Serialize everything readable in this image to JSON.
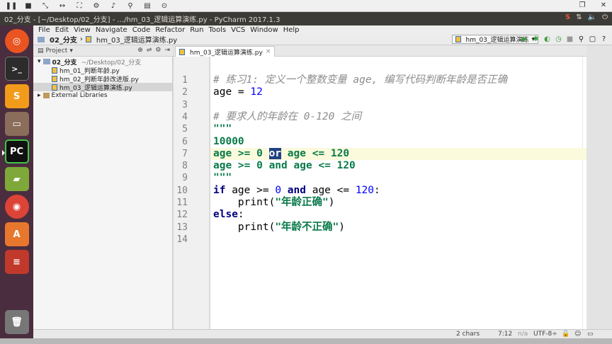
{
  "recorder": {
    "icons": [
      "pause-icon",
      "stop-icon",
      "resize-icon",
      "move-icon",
      "settings-icon",
      "mic-icon",
      "save-icon",
      "record-icon"
    ]
  },
  "window": {
    "title": "02_分支 - [~/Desktop/02_分支] - .../hm_03_逻辑运算演练.py - PyCharm 2017.1.3"
  },
  "menu": [
    "File",
    "Edit",
    "View",
    "Navigate",
    "Code",
    "Refactor",
    "Run",
    "Tools",
    "VCS",
    "Window",
    "Help"
  ],
  "nav": {
    "project": "02_分支",
    "file": "hm_03_逻辑运算演练.py",
    "run_config": "hm_03_逻辑运算演练"
  },
  "project_panel": {
    "header": "Project",
    "root_name": "02_分支",
    "root_path": "~/Desktop/02_分支",
    "files": [
      "hm_01_判断年龄.py",
      "hm_02_判断年龄改进版.py",
      "hm_03_逻辑运算演练.py"
    ],
    "selected_index": 2,
    "external": "External Libraries"
  },
  "editor": {
    "tab_label": "hm_03_逻辑运算演练.py",
    "current_line": 7,
    "line_numbers": [
      "1",
      "2",
      "3",
      "4",
      "5",
      "6",
      "7",
      "8",
      "9",
      "10",
      "11",
      "12",
      "13",
      "14"
    ],
    "lines": [
      [
        {
          "t": "# 练习1: 定义一个整数变量 age, 编写代码判断年龄是否正确",
          "c": "comment"
        }
      ],
      [
        {
          "t": "age = ",
          "c": "op"
        },
        {
          "t": "12",
          "c": "num"
        }
      ],
      [],
      [
        {
          "t": "# 要求人的年龄在 0-120 之间",
          "c": "comment"
        }
      ],
      [
        {
          "t": "\"\"\"",
          "c": "str"
        }
      ],
      [
        {
          "t": "10000",
          "c": "str"
        }
      ],
      [
        {
          "t": "age >= 0 ",
          "c": "str"
        },
        {
          "t": "or",
          "c": "sel"
        },
        {
          "t": " age <= 120",
          "c": "str"
        }
      ],
      [
        {
          "t": "age >= 0 and age <= 120",
          "c": "str"
        }
      ],
      [
        {
          "t": "\"\"\"",
          "c": "str"
        }
      ],
      [
        {
          "t": "if",
          "c": "kw"
        },
        {
          "t": " age >= ",
          "c": "op"
        },
        {
          "t": "0",
          "c": "num"
        },
        {
          "t": " ",
          "c": "op"
        },
        {
          "t": "and",
          "c": "kw"
        },
        {
          "t": " age <= ",
          "c": "op"
        },
        {
          "t": "120",
          "c": "num"
        },
        {
          "t": ":",
          "c": "op"
        }
      ],
      [
        {
          "t": "    print(",
          "c": "op"
        },
        {
          "t": "\"年龄正确\"",
          "c": "str"
        },
        {
          "t": ")",
          "c": "op"
        }
      ],
      [
        {
          "t": "else",
          "c": "kw"
        },
        {
          "t": ":",
          "c": "op"
        }
      ],
      [
        {
          "t": "    print(",
          "c": "op"
        },
        {
          "t": "\"年龄不正确\"",
          "c": "str"
        },
        {
          "t": ")",
          "c": "op"
        }
      ],
      []
    ]
  },
  "status": {
    "chars": "2 chars",
    "position": "7:12",
    "line_sep": "n/a",
    "encoding": "UTF-8÷"
  },
  "colors": {
    "comment": "#8c8c8c",
    "string": "#0a7a4a",
    "keyword": "#000080",
    "number": "#0000ff",
    "current_line": "#fbfadc",
    "selection": "#214283",
    "launcher": "#4a2d3e",
    "top_panel": "#3c3b37"
  }
}
